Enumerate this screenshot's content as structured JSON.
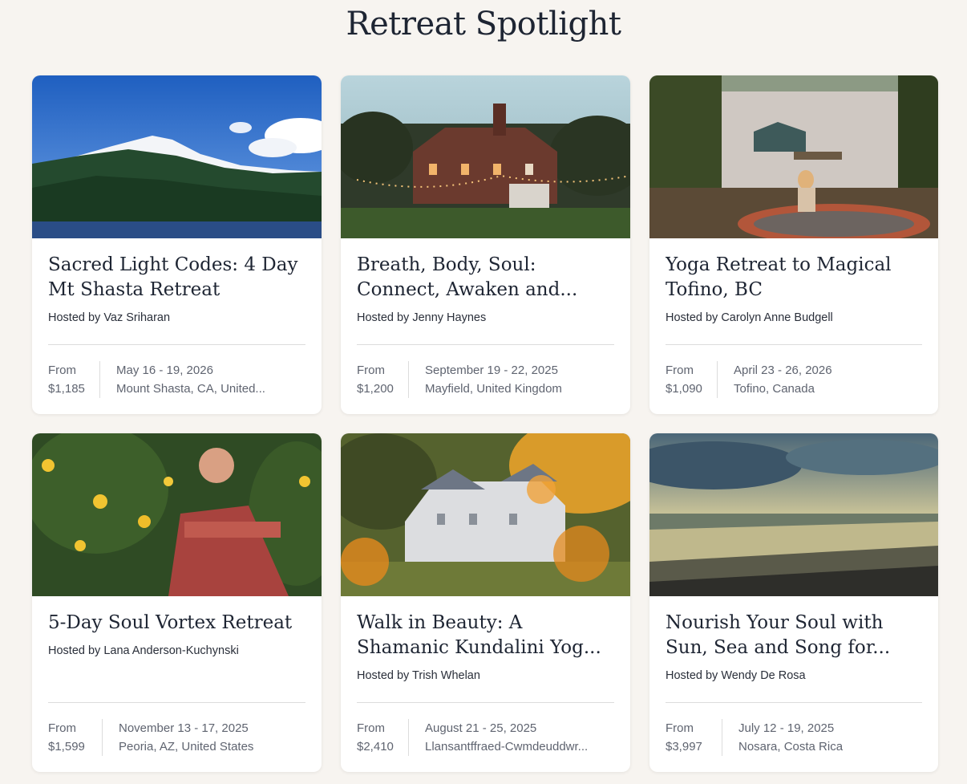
{
  "page": {
    "title": "Retreat Spotlight"
  },
  "price_label": "From",
  "cards": [
    {
      "title": "Sacred Light Codes: 4 Day Mt Shasta Retreat",
      "host": "Hosted by Vaz Sriharan",
      "price": "$1,185",
      "dates": "May 16 - 19, 2026",
      "location": "Mount Shasta, CA, United..."
    },
    {
      "title": "Breath, Body, Soul: Connect, Awaken and...",
      "host": "Hosted by Jenny Haynes",
      "price": "$1,200",
      "dates": "September 19 - 22, 2025",
      "location": "Mayfield, United Kingdom"
    },
    {
      "title": "Yoga Retreat to Magical Tofino, BC",
      "host": "Hosted by Carolyn Anne Budgell",
      "price": "$1,090",
      "dates": "April 23 - 26, 2026",
      "location": "Tofino, Canada"
    },
    {
      "title": "5-Day Soul Vortex Retreat",
      "host": "Hosted by Lana Anderson-Kuchynski",
      "price": "$1,599",
      "dates": "November 13 - 17, 2025",
      "location": "Peoria, AZ, United States"
    },
    {
      "title": "Walk in Beauty: A Shamanic Kundalini Yog...",
      "host": "Hosted by Trish Whelan",
      "price": "$2,410",
      "dates": "August 21 - 25, 2025",
      "location": "Llansantffraed-Cwmdeuddwr..."
    },
    {
      "title": "Nourish Your Soul with Sun, Sea and Song for...",
      "host": "Hosted by Wendy De Rosa",
      "price": "$3,997",
      "dates": "July 12 - 19, 2025",
      "location": "Nosara, Costa Rica"
    }
  ]
}
